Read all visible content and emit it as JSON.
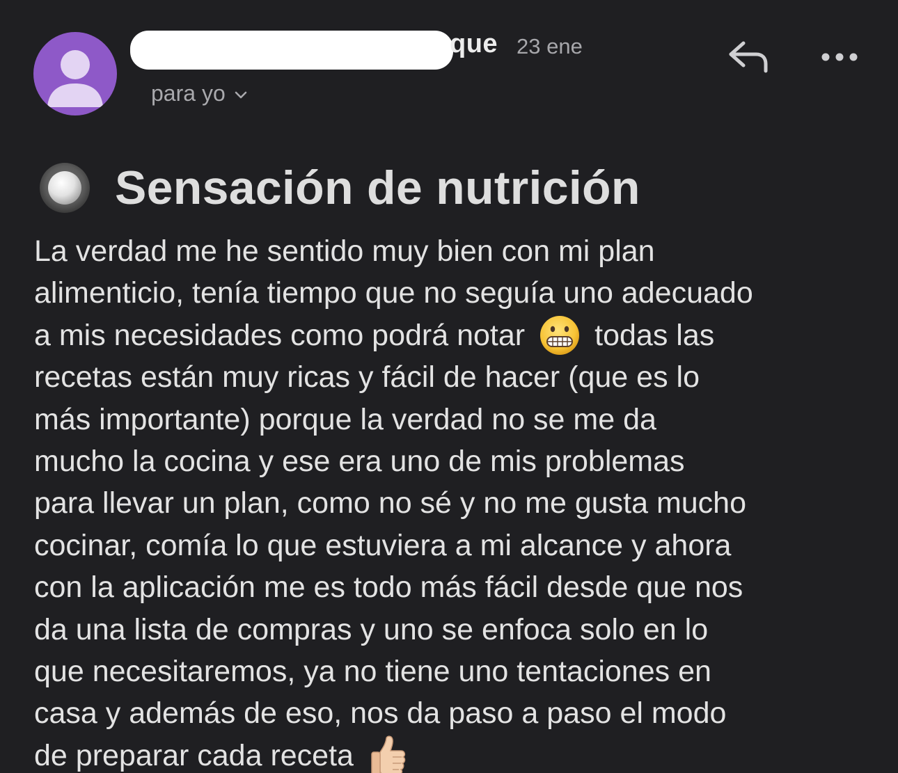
{
  "header": {
    "sender_visible": "que",
    "date": "23 ene",
    "recipient": "para yo",
    "reply_icon": "reply-icon",
    "more_icon": "more-options-icon",
    "avatar_color": "#8e59c8"
  },
  "message": {
    "subject": "Sensación de nutrición",
    "body_lines": [
      "La verdad me he sentido muy bien con mi plan",
      "alimenticio, tenía tiempo que no seguía uno adecuado",
      "a mis necesidades como podrá notar",
      "todas las",
      "recetas están muy ricas y fácil de hacer (que es lo",
      "más importante) porque la verdad no se me da",
      "mucho la cocina y ese era uno de mis problemas",
      "para llevar un plan, como no sé y no me gusta mucho",
      "cocinar, comía lo que estuviera a mi alcance y ahora",
      "con la aplicación me es todo más fácil desde que nos",
      "da una lista de compras y uno se enfoca solo en lo",
      "que necesitaremos, ya no tiene uno tentaciones en",
      "casa y además de eso, nos da paso a paso el modo",
      "de preparar cada receta"
    ],
    "emojis": [
      "grimacing-face-icon",
      "thumbs-up-icon"
    ]
  }
}
